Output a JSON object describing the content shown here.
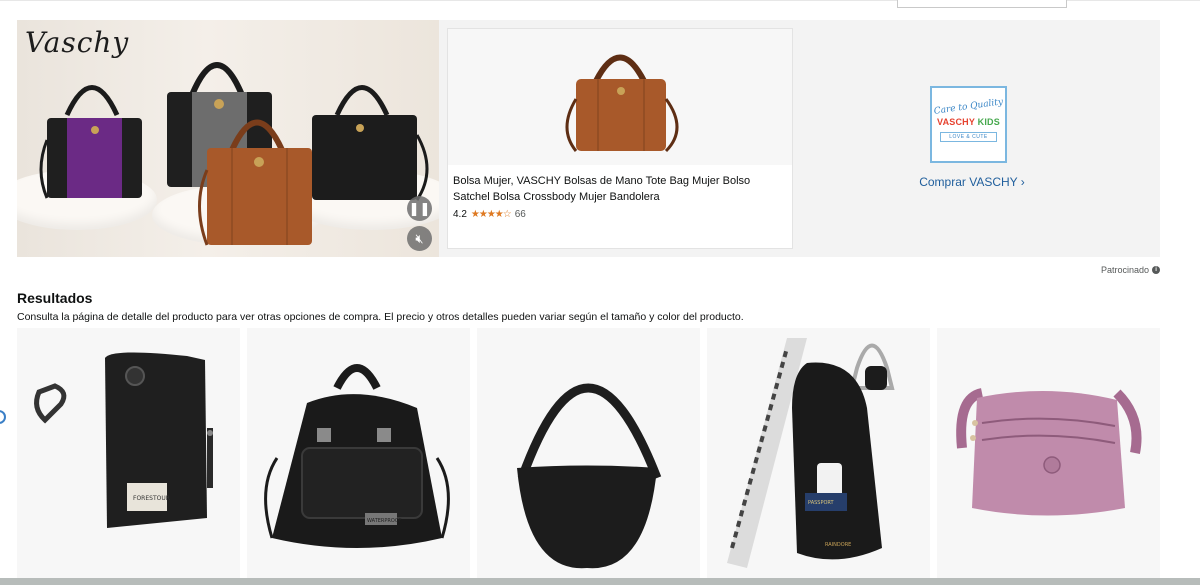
{
  "sponsored_banner": {
    "brand_logo_text": "Vaschy",
    "pause_icon": "pause-icon",
    "mute_icon": "speaker-muted-icon",
    "featured_product": {
      "title": "Bolsa Mujer, VASCHY Bolsas de Mano Tote Bag Mujer Bolso Satchel Bolsa Crossbody Mujer Bandolera",
      "rating": "4.2",
      "stars": "★★★★☆",
      "review_count": "66"
    },
    "kids_logo": {
      "line1": "Care to Quality",
      "word1": "VASCHY",
      "word2": "KIDS",
      "line3": "LOVE & CUTE"
    },
    "shop_link": "Comprar VASCHY ›",
    "sponsored_label": "Patrocinado",
    "info_icon": "info-icon"
  },
  "results": {
    "heading": "Resultados",
    "subheading": "Consulta la página de detalle del producto para ver otras opciones de compra. El precio y otros detalles pueden variar según el tamaño y color del producto.",
    "cards": [
      {
        "name": "black-phone-crossbody-bag",
        "badge_text": "FORESTOUR"
      },
      {
        "name": "black-nylon-tote-bag",
        "badge_text": "WATERPROOF"
      },
      {
        "name": "black-half-moon-bag",
        "badge_text": ""
      },
      {
        "name": "black-sling-chest-bag",
        "badge_text": "RAINDORE",
        "passport_text": "PASSPORT"
      },
      {
        "name": "pink-multi-pocket-crossbody-bag",
        "badge_text": ""
      }
    ]
  },
  "colors": {
    "link": "#1f5e9c",
    "star": "#de7921",
    "brown_bag": "#a8592a",
    "purple_bag": "#6b2a85"
  }
}
